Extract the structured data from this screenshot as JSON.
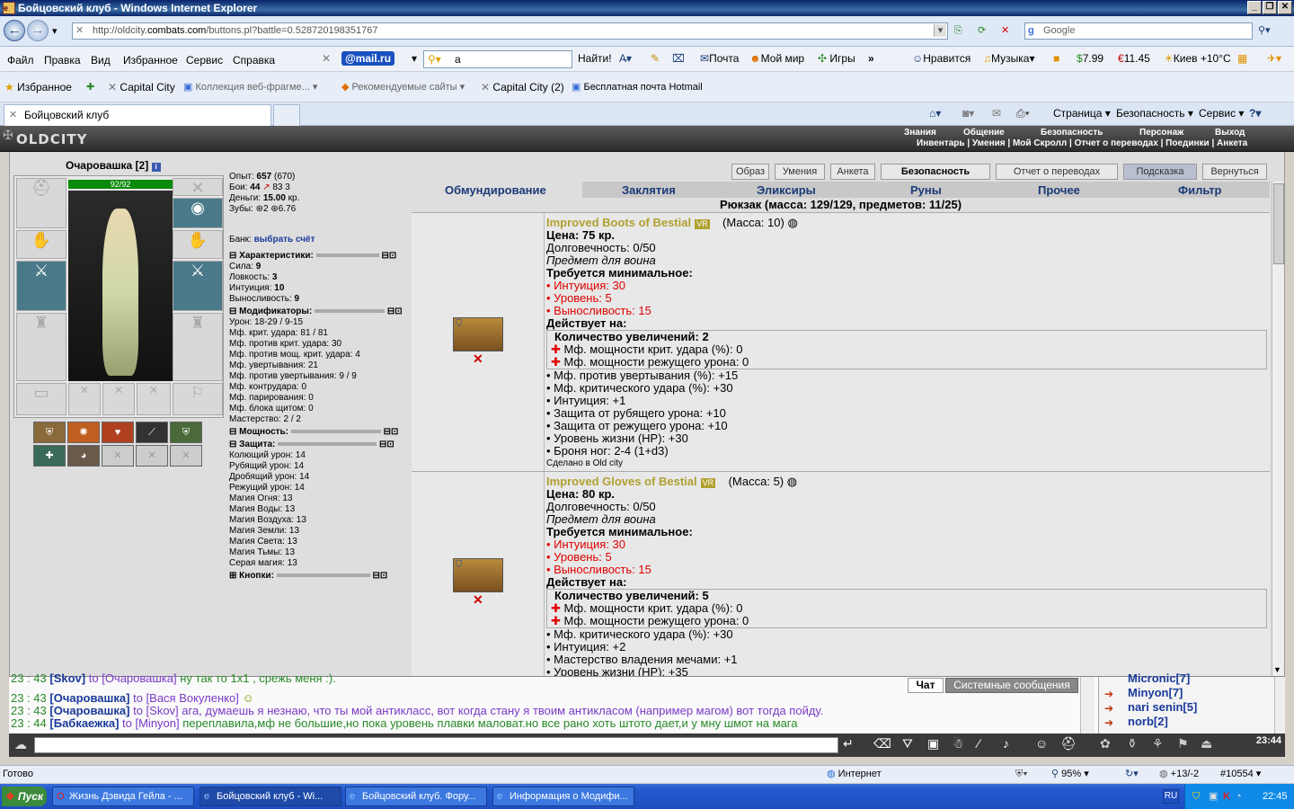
{
  "window": {
    "title": "Бойцовский клуб - Windows Internet Explorer"
  },
  "browser": {
    "url_prefix": "http://oldcity.",
    "url_host": "combats.com",
    "url_rest": "/buttons.pl?battle=0.528720198351767",
    "search_placeholder": "Google",
    "menu": [
      "Файл",
      "Правка",
      "Вид",
      "Избранное",
      "Сервис",
      "Справка"
    ],
    "mailru": "@mail.ru",
    "mailru_search": "a",
    "find": "Найти!",
    "toolbar_items": [
      "Почта",
      "Мой мир",
      "Игры",
      "Нравится",
      "Музыка"
    ],
    "money1": "7.99",
    "money2": "11.45",
    "weather": "Киев +10°C",
    "favorites_label": "Избранное",
    "favorites": [
      "Capital City",
      "Коллекция веб-фрагме...",
      "Рекомендуемые сайты",
      "Capital City (2)",
      "Бесплатная почта Hotmail"
    ],
    "tab_title": "Бойцовский клуб",
    "commands": [
      "Страница",
      "Безопасность",
      "Сервис"
    ],
    "status_text": "Готово",
    "zone": "Интернет",
    "zoom": "95%",
    "status_extra": "+13/-2",
    "status_num": "#10554"
  },
  "game": {
    "logo": "OLDCITY",
    "nav": [
      "Знания",
      "Общение",
      "Безопасность",
      "Персонаж",
      "Выход"
    ],
    "subnav": "Инвентарь | Умения | Мой Скролл | Отчет о переводах | Поединки | Анкета",
    "char_name": "Очаровашка",
    "char_level": "[2]",
    "hp": "92/92",
    "top_buttons": [
      "Образ",
      "Умения",
      "Анкета",
      "Безопасность",
      "Отчет о переводах",
      "Подсказка",
      "Вернуться"
    ],
    "tabs": [
      "Обмундирование",
      "Заклятия",
      "Эликсиры",
      "Руны",
      "Прочее",
      "Фильтр"
    ],
    "backpack": "Рюкзак (масса: 129/129, предметов: 11/25)",
    "stats_top": [
      {
        "label": "Опыт:",
        "value": "657",
        "extra": "(670)"
      },
      {
        "label": "Бои:",
        "value": "44",
        "extra": "83   3"
      },
      {
        "label": "Деньги:",
        "value": "15.00",
        "extra": "кр."
      },
      {
        "label": "Зубы:",
        "value": "2",
        "extra": "6.76"
      }
    ],
    "bank_label": "Банк:",
    "bank_link": "выбрать счёт",
    "sections": {
      "char": "Характеристики:",
      "mods": "Модификаторы:",
      "power": "Мощность:",
      "defense": "Защита:",
      "buttons": "Кнопки:"
    },
    "char_stats": [
      {
        "label": "Сила:",
        "value": "9"
      },
      {
        "label": "Ловкость:",
        "value": "3"
      },
      {
        "label": "Интуиция:",
        "value": "10"
      },
      {
        "label": "Выносливость:",
        "value": "9"
      }
    ],
    "modifiers": [
      "Урон: 18-29 / 9-15",
      "Мф. крит. удара: 81 / 81",
      "Мф. против крит. удара: 30",
      "Мф. против мощ. крит. удара: 4",
      "Мф. увертывания: 21",
      "Мф. против увертывания: 9 / 9",
      "Мф. контрудара: 0",
      "Мф. парирования: 0",
      "Мф. блока щитом: 0",
      "Мастерство: 2 / 2"
    ],
    "defense": [
      "Колющий урон: 14",
      "Рубящий урон: 14",
      "Дробящий урон: 14",
      "Режущий урон: 14",
      "Магия Огня: 13",
      "Магия Воды: 13",
      "Магия Воздуха: 13",
      "Магия Земли: 13",
      "Магия Света: 13",
      "Магия Тьмы: 13",
      "Серая магия: 13"
    ],
    "items": [
      {
        "name": "Improved Boots of Bestial",
        "vr": "VR",
        "mass": "(Масса: 10)",
        "price": "Цена: 75 кр.",
        "durability": "Долговечность: 0/50",
        "for": "Предмет для воина",
        "req_title": "Требуется минимальное:",
        "reqs": [
          "Интуиция: 30",
          "Уровень: 5",
          "Выносливость: 15"
        ],
        "acts": "Действует на:",
        "upgrades": "Количество увеличений: 2",
        "up_list": [
          "Мф. мощности крит. удара (%): 0",
          "Мф. мощности режущего урона: 0"
        ],
        "effects": [
          "Мф. против увертывания (%): +15",
          "Мф. критического удара (%): +30",
          "Интуиция: +1",
          "Защита от рубящего урона: +10",
          "Защита от режущего урона: +10",
          "Уровень жизни (HP): +30",
          "Броня ног: 2-4 (1+d3)"
        ],
        "made": "Сделано в Old city"
      },
      {
        "name": "Improved Gloves of Bestial",
        "vr": "VR",
        "mass": "(Масса: 5)",
        "price": "Цена: 80 кр.",
        "durability": "Долговечность: 0/50",
        "for": "Предмет для воина",
        "req_title": "Требуется минимальное:",
        "reqs": [
          "Интуиция: 30",
          "Уровень: 5",
          "Выносливость: 15"
        ],
        "acts": "Действует на:",
        "upgrades": "Количество увеличений: 5",
        "up_list": [
          "Мф. мощности крит. удара (%): 0",
          "Мф. мощности режущего урона: 0"
        ],
        "effects": [
          "Мф. критического удара (%): +30",
          "Интуиция: +2",
          "Мастерство владения мечами: +1",
          "Уровень жизни (HP): +35"
        ],
        "made": ""
      }
    ],
    "chat": {
      "tabs": [
        "Чат",
        "Системные сообщения"
      ],
      "lines": [
        {
          "time": "23 : 43",
          "from": "[Skov]",
          "to": "to [Очаровашка]",
          "text": " ну так то 1х1 , срежь меня :)."
        },
        {
          "time": "23 : 43",
          "from": "[Очаровашка]",
          "to": "to [Вася Вокуленко]",
          "text": ""
        },
        {
          "time": "23 : 43",
          "from": "[Очаровашка]",
          "to": "to [Skov]",
          "text": " ага, думаешь я незнаю, что ты мой антикласс, вот когда стану я твоим антикласом (например магом) вот тогда пойду."
        },
        {
          "time": "23 : 44",
          "from": "[Бабкаежка]",
          "to": "to [Minyon]",
          "text": " переплавила,мф не большие,но пока уровень плавки маловат.но все рано хоть штото дает,и у мну шмот на мага"
        }
      ],
      "users": [
        "Micronic[7]",
        "Minyon[7]",
        "nari senin[5]",
        "norb[2]"
      ],
      "clock": "23:44"
    }
  },
  "taskbar": {
    "start": "Пуск",
    "tasks": [
      "Жизнь Дэвида Гейла - ...",
      "Бойцовский клуб - Wi...",
      "Бойцовский клуб. Фору...",
      "Информация о Модифи..."
    ],
    "lang": "RU",
    "time": "22:45"
  }
}
